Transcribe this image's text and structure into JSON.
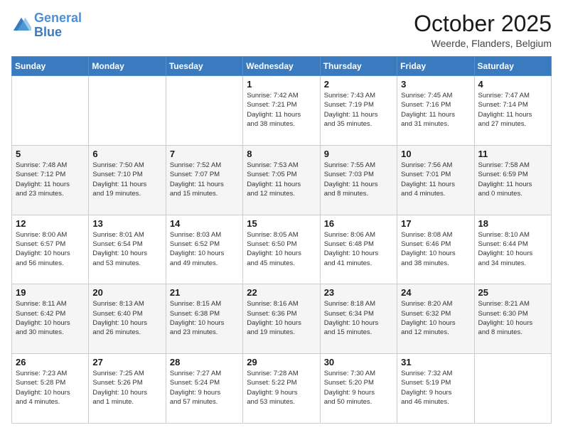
{
  "logo": {
    "line1": "General",
    "line2": "Blue"
  },
  "header": {
    "month": "October 2025",
    "location": "Weerde, Flanders, Belgium"
  },
  "weekdays": [
    "Sunday",
    "Monday",
    "Tuesday",
    "Wednesday",
    "Thursday",
    "Friday",
    "Saturday"
  ],
  "weeks": [
    [
      {
        "day": "",
        "info": ""
      },
      {
        "day": "",
        "info": ""
      },
      {
        "day": "",
        "info": ""
      },
      {
        "day": "1",
        "info": "Sunrise: 7:42 AM\nSunset: 7:21 PM\nDaylight: 11 hours\nand 38 minutes."
      },
      {
        "day": "2",
        "info": "Sunrise: 7:43 AM\nSunset: 7:19 PM\nDaylight: 11 hours\nand 35 minutes."
      },
      {
        "day": "3",
        "info": "Sunrise: 7:45 AM\nSunset: 7:16 PM\nDaylight: 11 hours\nand 31 minutes."
      },
      {
        "day": "4",
        "info": "Sunrise: 7:47 AM\nSunset: 7:14 PM\nDaylight: 11 hours\nand 27 minutes."
      }
    ],
    [
      {
        "day": "5",
        "info": "Sunrise: 7:48 AM\nSunset: 7:12 PM\nDaylight: 11 hours\nand 23 minutes."
      },
      {
        "day": "6",
        "info": "Sunrise: 7:50 AM\nSunset: 7:10 PM\nDaylight: 11 hours\nand 19 minutes."
      },
      {
        "day": "7",
        "info": "Sunrise: 7:52 AM\nSunset: 7:07 PM\nDaylight: 11 hours\nand 15 minutes."
      },
      {
        "day": "8",
        "info": "Sunrise: 7:53 AM\nSunset: 7:05 PM\nDaylight: 11 hours\nand 12 minutes."
      },
      {
        "day": "9",
        "info": "Sunrise: 7:55 AM\nSunset: 7:03 PM\nDaylight: 11 hours\nand 8 minutes."
      },
      {
        "day": "10",
        "info": "Sunrise: 7:56 AM\nSunset: 7:01 PM\nDaylight: 11 hours\nand 4 minutes."
      },
      {
        "day": "11",
        "info": "Sunrise: 7:58 AM\nSunset: 6:59 PM\nDaylight: 11 hours\nand 0 minutes."
      }
    ],
    [
      {
        "day": "12",
        "info": "Sunrise: 8:00 AM\nSunset: 6:57 PM\nDaylight: 10 hours\nand 56 minutes."
      },
      {
        "day": "13",
        "info": "Sunrise: 8:01 AM\nSunset: 6:54 PM\nDaylight: 10 hours\nand 53 minutes."
      },
      {
        "day": "14",
        "info": "Sunrise: 8:03 AM\nSunset: 6:52 PM\nDaylight: 10 hours\nand 49 minutes."
      },
      {
        "day": "15",
        "info": "Sunrise: 8:05 AM\nSunset: 6:50 PM\nDaylight: 10 hours\nand 45 minutes."
      },
      {
        "day": "16",
        "info": "Sunrise: 8:06 AM\nSunset: 6:48 PM\nDaylight: 10 hours\nand 41 minutes."
      },
      {
        "day": "17",
        "info": "Sunrise: 8:08 AM\nSunset: 6:46 PM\nDaylight: 10 hours\nand 38 minutes."
      },
      {
        "day": "18",
        "info": "Sunrise: 8:10 AM\nSunset: 6:44 PM\nDaylight: 10 hours\nand 34 minutes."
      }
    ],
    [
      {
        "day": "19",
        "info": "Sunrise: 8:11 AM\nSunset: 6:42 PM\nDaylight: 10 hours\nand 30 minutes."
      },
      {
        "day": "20",
        "info": "Sunrise: 8:13 AM\nSunset: 6:40 PM\nDaylight: 10 hours\nand 26 minutes."
      },
      {
        "day": "21",
        "info": "Sunrise: 8:15 AM\nSunset: 6:38 PM\nDaylight: 10 hours\nand 23 minutes."
      },
      {
        "day": "22",
        "info": "Sunrise: 8:16 AM\nSunset: 6:36 PM\nDaylight: 10 hours\nand 19 minutes."
      },
      {
        "day": "23",
        "info": "Sunrise: 8:18 AM\nSunset: 6:34 PM\nDaylight: 10 hours\nand 15 minutes."
      },
      {
        "day": "24",
        "info": "Sunrise: 8:20 AM\nSunset: 6:32 PM\nDaylight: 10 hours\nand 12 minutes."
      },
      {
        "day": "25",
        "info": "Sunrise: 8:21 AM\nSunset: 6:30 PM\nDaylight: 10 hours\nand 8 minutes."
      }
    ],
    [
      {
        "day": "26",
        "info": "Sunrise: 7:23 AM\nSunset: 5:28 PM\nDaylight: 10 hours\nand 4 minutes."
      },
      {
        "day": "27",
        "info": "Sunrise: 7:25 AM\nSunset: 5:26 PM\nDaylight: 10 hours\nand 1 minute."
      },
      {
        "day": "28",
        "info": "Sunrise: 7:27 AM\nSunset: 5:24 PM\nDaylight: 9 hours\nand 57 minutes."
      },
      {
        "day": "29",
        "info": "Sunrise: 7:28 AM\nSunset: 5:22 PM\nDaylight: 9 hours\nand 53 minutes."
      },
      {
        "day": "30",
        "info": "Sunrise: 7:30 AM\nSunset: 5:20 PM\nDaylight: 9 hours\nand 50 minutes."
      },
      {
        "day": "31",
        "info": "Sunrise: 7:32 AM\nSunset: 5:19 PM\nDaylight: 9 hours\nand 46 minutes."
      },
      {
        "day": "",
        "info": ""
      }
    ]
  ]
}
